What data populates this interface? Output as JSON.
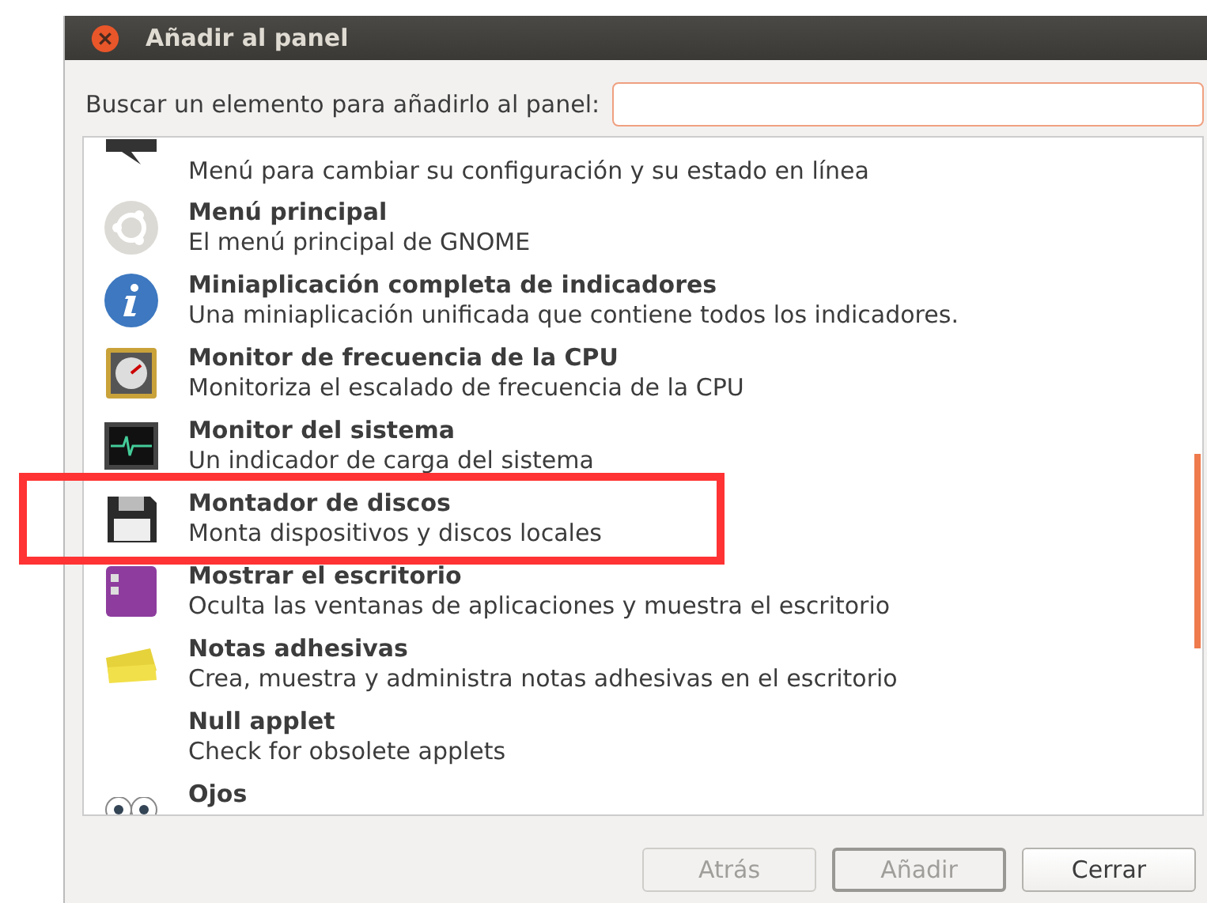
{
  "window": {
    "title": "Añadir al panel"
  },
  "search": {
    "label": "Buscar un elemento para añadirlo al panel:"
  },
  "items": [
    {
      "description": "Menú para cambiar su configuración y su estado en línea",
      "highlighted": false
    },
    {
      "title": "Menú principal",
      "description": "El menú principal de GNOME",
      "highlighted": false
    },
    {
      "title": "Miniaplicación completa de indicadores",
      "description": "Una miniaplicación unificada que contiene todos los indicadores.",
      "highlighted": false
    },
    {
      "title": "Monitor de frecuencia de la CPU",
      "description": "Monitoriza el escalado de frecuencia de la CPU",
      "highlighted": false
    },
    {
      "title": "Monitor del sistema",
      "description": "Un indicador de carga del sistema",
      "highlighted": false
    },
    {
      "title": "Montador de discos",
      "description": "Monta dispositivos y discos locales",
      "highlighted": true
    },
    {
      "title": "Mostrar el escritorio",
      "description": "Oculta las ventanas de aplicaciones y muestra el escritorio",
      "highlighted": false
    },
    {
      "title": "Notas adhesivas",
      "description": "Crea, muestra y administra notas adhesivas en el escritorio",
      "highlighted": false
    },
    {
      "title": "Null applet",
      "description": "Check for obsolete applets",
      "highlighted": false
    },
    {
      "title": "Ojos",
      "highlighted": false
    }
  ],
  "buttons": [
    {
      "label": "Atrás",
      "disabled": true
    },
    {
      "label": "Añadir",
      "disabled": true
    },
    {
      "label": "Cerrar",
      "disabled": false
    }
  ]
}
